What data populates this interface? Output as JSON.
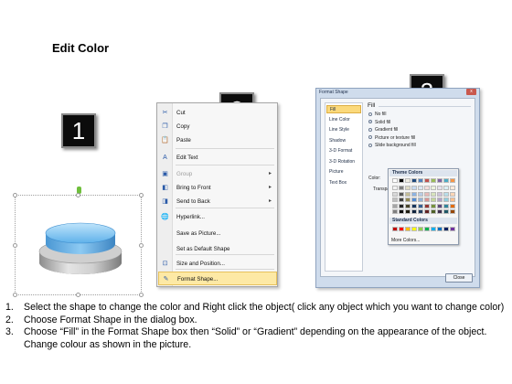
{
  "title": "Edit Color",
  "step_numbers": [
    "1",
    "2",
    "3"
  ],
  "context_menu": {
    "items": [
      {
        "icon": "cut-icon",
        "glyph": "✂",
        "label": "Cut",
        "enabled": true,
        "submenu": false
      },
      {
        "icon": "copy-icon",
        "glyph": "❐",
        "label": "Copy",
        "enabled": true,
        "submenu": false
      },
      {
        "icon": "paste-icon",
        "glyph": "📋",
        "label": "Paste",
        "enabled": true,
        "submenu": false
      },
      {
        "icon": "edit-text-icon",
        "glyph": "A",
        "label": "Edit Text",
        "enabled": true,
        "submenu": false
      },
      {
        "icon": "group-icon",
        "glyph": "▣",
        "label": "Group",
        "enabled": false,
        "submenu": true
      },
      {
        "icon": "bring-to-front-icon",
        "glyph": "◧",
        "label": "Bring to Front",
        "enabled": true,
        "submenu": true
      },
      {
        "icon": "send-to-back-icon",
        "glyph": "◨",
        "label": "Send to Back",
        "enabled": true,
        "submenu": true
      },
      {
        "icon": "hyperlink-icon",
        "glyph": "🌐",
        "label": "Hyperlink...",
        "enabled": true,
        "submenu": false
      },
      {
        "icon": "",
        "glyph": "",
        "label": "Save as Picture...",
        "enabled": true,
        "submenu": false
      },
      {
        "icon": "",
        "glyph": "",
        "label": "Set as Default Shape",
        "enabled": true,
        "submenu": false
      },
      {
        "icon": "size-position-icon",
        "glyph": "⊡",
        "label": "Size and Position...",
        "enabled": true,
        "submenu": false
      },
      {
        "icon": "format-shape-icon",
        "glyph": "✎",
        "label": "Format Shape...",
        "enabled": true,
        "submenu": false,
        "highlighted": true
      }
    ]
  },
  "dialog": {
    "title": "Format Shape",
    "close_x": "x",
    "nav": [
      "Fill",
      "Line Color",
      "Line Style",
      "Shadow",
      "3-D Format",
      "3-D Rotation",
      "Picture",
      "Text Box"
    ],
    "active_nav": "Fill",
    "section_title": "Fill",
    "options": [
      {
        "label": "No fill",
        "selected": false
      },
      {
        "label": "Solid fill",
        "selected": true
      },
      {
        "label": "Gradient fill",
        "selected": false
      },
      {
        "label": "Picture or texture fill",
        "selected": false
      },
      {
        "label": "Slide background fill",
        "selected": false
      }
    ],
    "color_label": "Color:",
    "transparency_label": "Transpa",
    "close_button": "Close"
  },
  "palette": {
    "theme_label": "Theme Colors",
    "standard_label": "Standard Colors",
    "more_label": "More Colors...",
    "theme_top": [
      "#ffffff",
      "#000000",
      "#eeece1",
      "#1f497d",
      "#4f81bd",
      "#c0504d",
      "#9bbb59",
      "#8064a2",
      "#4bacc6",
      "#f79646"
    ],
    "theme_shades": [
      [
        "#f2f2f2",
        "#7f7f7f",
        "#ddd9c3",
        "#c6d9f0",
        "#dbe5f1",
        "#f2dcdb",
        "#ebf1dd",
        "#e5e0ec",
        "#dbeef3",
        "#fdeada"
      ],
      [
        "#d8d8d8",
        "#595959",
        "#c4bd97",
        "#8db3e2",
        "#b8cce4",
        "#e5b9b7",
        "#d7e3bc",
        "#ccc1d9",
        "#b7dde8",
        "#fbd5b5"
      ],
      [
        "#bfbfbf",
        "#3f3f3f",
        "#938953",
        "#548dd4",
        "#95b3d7",
        "#d99694",
        "#c3d69b",
        "#b2a2c7",
        "#92cddc",
        "#fac08f"
      ],
      [
        "#a5a5a5",
        "#262626",
        "#494429",
        "#17365d",
        "#366092",
        "#953734",
        "#76923c",
        "#5f497a",
        "#31859b",
        "#e36c09"
      ],
      [
        "#7f7f7f",
        "#0c0c0c",
        "#1d1b10",
        "#0f243e",
        "#244061",
        "#632423",
        "#4f6128",
        "#3f3151",
        "#205867",
        "#974806"
      ]
    ],
    "standard": [
      "#c00000",
      "#ff0000",
      "#ffc000",
      "#ffff00",
      "#92d050",
      "#00b050",
      "#00b0f0",
      "#0070c0",
      "#002060",
      "#7030a0"
    ]
  },
  "instructions": [
    {
      "num": "1.",
      "text": "Select the shape to change the color and Right click the object( click any object which you want to change color)"
    },
    {
      "num": "2.",
      "text": "Choose Format Shape in the dialog box."
    },
    {
      "num": "3.",
      "text": "Choose “Fill” in the Format Shape box then “Solid” or “Gradient” depending on the appearance of the object. Change colour as shown in the picture."
    }
  ]
}
